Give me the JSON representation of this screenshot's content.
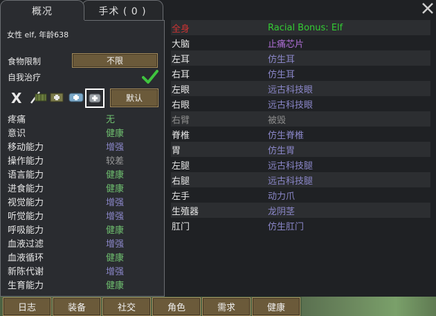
{
  "tabs": [
    {
      "label": "概况"
    },
    {
      "label": "手术 ( 0 )"
    }
  ],
  "overview": {
    "gender_age": "女性 elf, 年龄638",
    "food_restriction_label": "食物限制",
    "food_restriction_value": "不限",
    "self_tend_label": "自我治疗",
    "default_button": "默认",
    "x_glyph": "X"
  },
  "capacities": [
    {
      "name": "疼痛",
      "value": "无",
      "color": "#6fbf6f"
    },
    {
      "name": "意识",
      "value": "健康",
      "color": "#6fbf6f"
    },
    {
      "name": "移动能力",
      "value": "增强",
      "color": "#8a86c8"
    },
    {
      "name": "操作能力",
      "value": "较差",
      "color": "#9a9a9a"
    },
    {
      "name": "语言能力",
      "value": "健康",
      "color": "#6fbf6f"
    },
    {
      "name": "进食能力",
      "value": "健康",
      "color": "#6fbf6f"
    },
    {
      "name": "视觉能力",
      "value": "增强",
      "color": "#8a86c8"
    },
    {
      "name": "听觉能力",
      "value": "增强",
      "color": "#8a86c8"
    },
    {
      "name": "呼吸能力",
      "value": "健康",
      "color": "#6fbf6f"
    },
    {
      "name": "血液过滤",
      "value": "增强",
      "color": "#8a86c8"
    },
    {
      "name": "血液循环",
      "value": "健康",
      "color": "#6fbf6f"
    },
    {
      "name": "新陈代谢",
      "value": "增强",
      "color": "#8a86c8"
    },
    {
      "name": "生育能力",
      "value": "健康",
      "color": "#6fbf6f"
    }
  ],
  "hediffs": [
    {
      "part": "全身",
      "value": "Racial Bonus: Elf",
      "part_color": "#cc3333",
      "value_color": "#33cc33"
    },
    {
      "part": "大脑",
      "value": "止痛芯片",
      "part_color": "#e6e6e6",
      "value_color": "#b070d8"
    },
    {
      "part": "左耳",
      "value": "仿生耳",
      "part_color": "#e6e6e6",
      "value_color": "#8a86c8"
    },
    {
      "part": "右耳",
      "value": "仿生耳",
      "part_color": "#e6e6e6",
      "value_color": "#8a86c8"
    },
    {
      "part": "左眼",
      "value": "远古科技眼",
      "part_color": "#e6e6e6",
      "value_color": "#8a86c8"
    },
    {
      "part": "右眼",
      "value": "远古科技眼",
      "part_color": "#e6e6e6",
      "value_color": "#8a86c8"
    },
    {
      "part": "右臂",
      "value": "被毁",
      "part_color": "#8c8c8c",
      "value_color": "#8c8c8c"
    },
    {
      "part": "脊椎",
      "value": "仿生脊椎",
      "part_color": "#e6e6e6",
      "value_color": "#8a86c8"
    },
    {
      "part": "胃",
      "value": "仿生胃",
      "part_color": "#e6e6e6",
      "value_color": "#8a86c8"
    },
    {
      "part": "左腿",
      "value": "远古科技腿",
      "part_color": "#e6e6e6",
      "value_color": "#8a86c8"
    },
    {
      "part": "右腿",
      "value": "远古科技腿",
      "part_color": "#e6e6e6",
      "value_color": "#8a86c8"
    },
    {
      "part": "左手",
      "value": "动力爪",
      "part_color": "#e6e6e6",
      "value_color": "#8a86c8"
    },
    {
      "part": "生殖器",
      "value": "龙阴茎",
      "part_color": "#e6e6e6",
      "value_color": "#8a86c8"
    },
    {
      "part": "肛门",
      "value": "仿生肛门",
      "part_color": "#e6e6e6",
      "value_color": "#8a86c8"
    }
  ],
  "bottom_tabs": [
    {
      "label": "日志"
    },
    {
      "label": "装备"
    },
    {
      "label": "社交"
    },
    {
      "label": "角色"
    },
    {
      "label": "需求"
    },
    {
      "label": "健康"
    }
  ],
  "colors": {
    "button_bg": "#6b5a3a",
    "panel_bg": "#2a2c30",
    "check": "#3fc43f"
  }
}
